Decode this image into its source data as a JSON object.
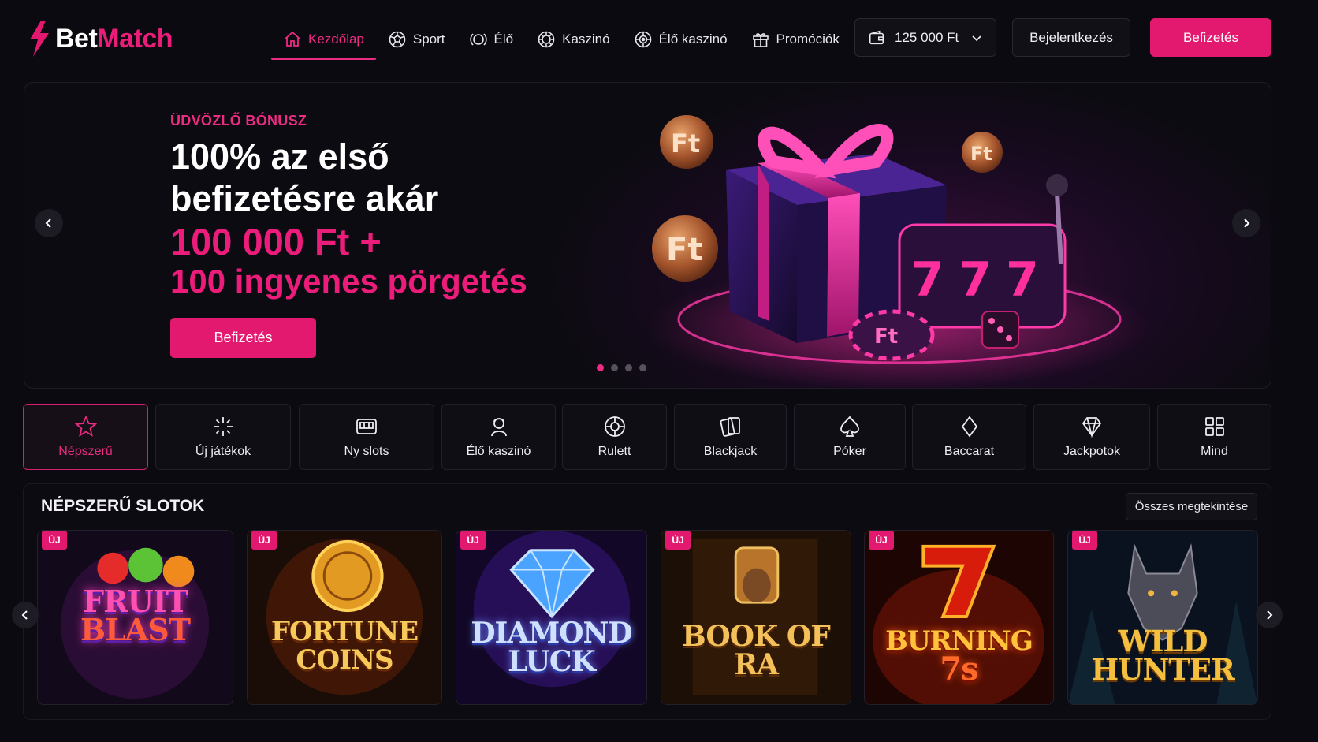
{
  "brand": {
    "name_part1": "Bet",
    "name_part2": "Match"
  },
  "nav": {
    "items": [
      {
        "label": "Kezdőlap",
        "icon": "home-icon",
        "active": true
      },
      {
        "label": "Sport",
        "icon": "soccer-ball-icon"
      },
      {
        "label": "Élő",
        "icon": "live-icon"
      },
      {
        "label": "Kaszinó",
        "icon": "casino-chip-icon"
      },
      {
        "label": "Élő kaszinó",
        "icon": "live-casino-icon"
      },
      {
        "label": "Promóciók",
        "icon": "gift-icon"
      }
    ]
  },
  "wallet": {
    "balance": "125 000 Ft",
    "icon": "wallet-icon"
  },
  "header": {
    "login_label": "Bejelentkezés",
    "deposit_label": "Befizetés"
  },
  "hero": {
    "eyebrow": "ÜDVÖZLŐ BÓNUSZ",
    "line1": "100% az első",
    "line2": "befizetésre akár",
    "line3": "100 000 Ft +",
    "line4": "100 ingyenes pörgetés",
    "button_label": "Befizetés",
    "slide_count": 4,
    "active_slide": 1,
    "art_coin_label": "Ft",
    "art_reel_symbol": "7"
  },
  "categories": [
    {
      "label": "Népszerű",
      "icon": "star-icon",
      "active": true
    },
    {
      "label": "Új játékok",
      "icon": "sparkle-icon"
    },
    {
      "label": "Ny slots",
      "icon": "slot-machine-icon"
    },
    {
      "label": "Élő kaszinó",
      "icon": "dealer-icon"
    },
    {
      "label": "Rulett",
      "icon": "roulette-icon"
    },
    {
      "label": "Blackjack",
      "icon": "cards-icon"
    },
    {
      "label": "Póker",
      "icon": "spade-icon"
    },
    {
      "label": "Baccarat",
      "icon": "diamond-suit-icon"
    },
    {
      "label": "Jackpotok",
      "icon": "gem-icon"
    },
    {
      "label": "Mind",
      "icon": "grid-icon"
    }
  ],
  "slots": {
    "title": "NÉPSZERŰ SLOTOK",
    "view_all_label": "Összes megtekintése",
    "badge_label": "ÚJ",
    "games": [
      {
        "line1": "FRUIT",
        "line2": "BLAST",
        "accent": "#ff4fb0"
      },
      {
        "line1": "FORTUNE",
        "line2": "COINS",
        "accent": "#f5b53a"
      },
      {
        "line1": "DIAMOND",
        "line2": "LUCK",
        "accent": "#9ec3ff"
      },
      {
        "line1": "BOOK OF",
        "line2": "RA",
        "accent": "#f0b44a"
      },
      {
        "line1": "BURNING",
        "line2": "7s",
        "accent": "#ffb12a"
      },
      {
        "line1": "WILD",
        "line2": "HUNTER",
        "accent": "#f2b640"
      }
    ]
  },
  "colors": {
    "accent": "#e3196f",
    "background": "#0b0a10"
  }
}
